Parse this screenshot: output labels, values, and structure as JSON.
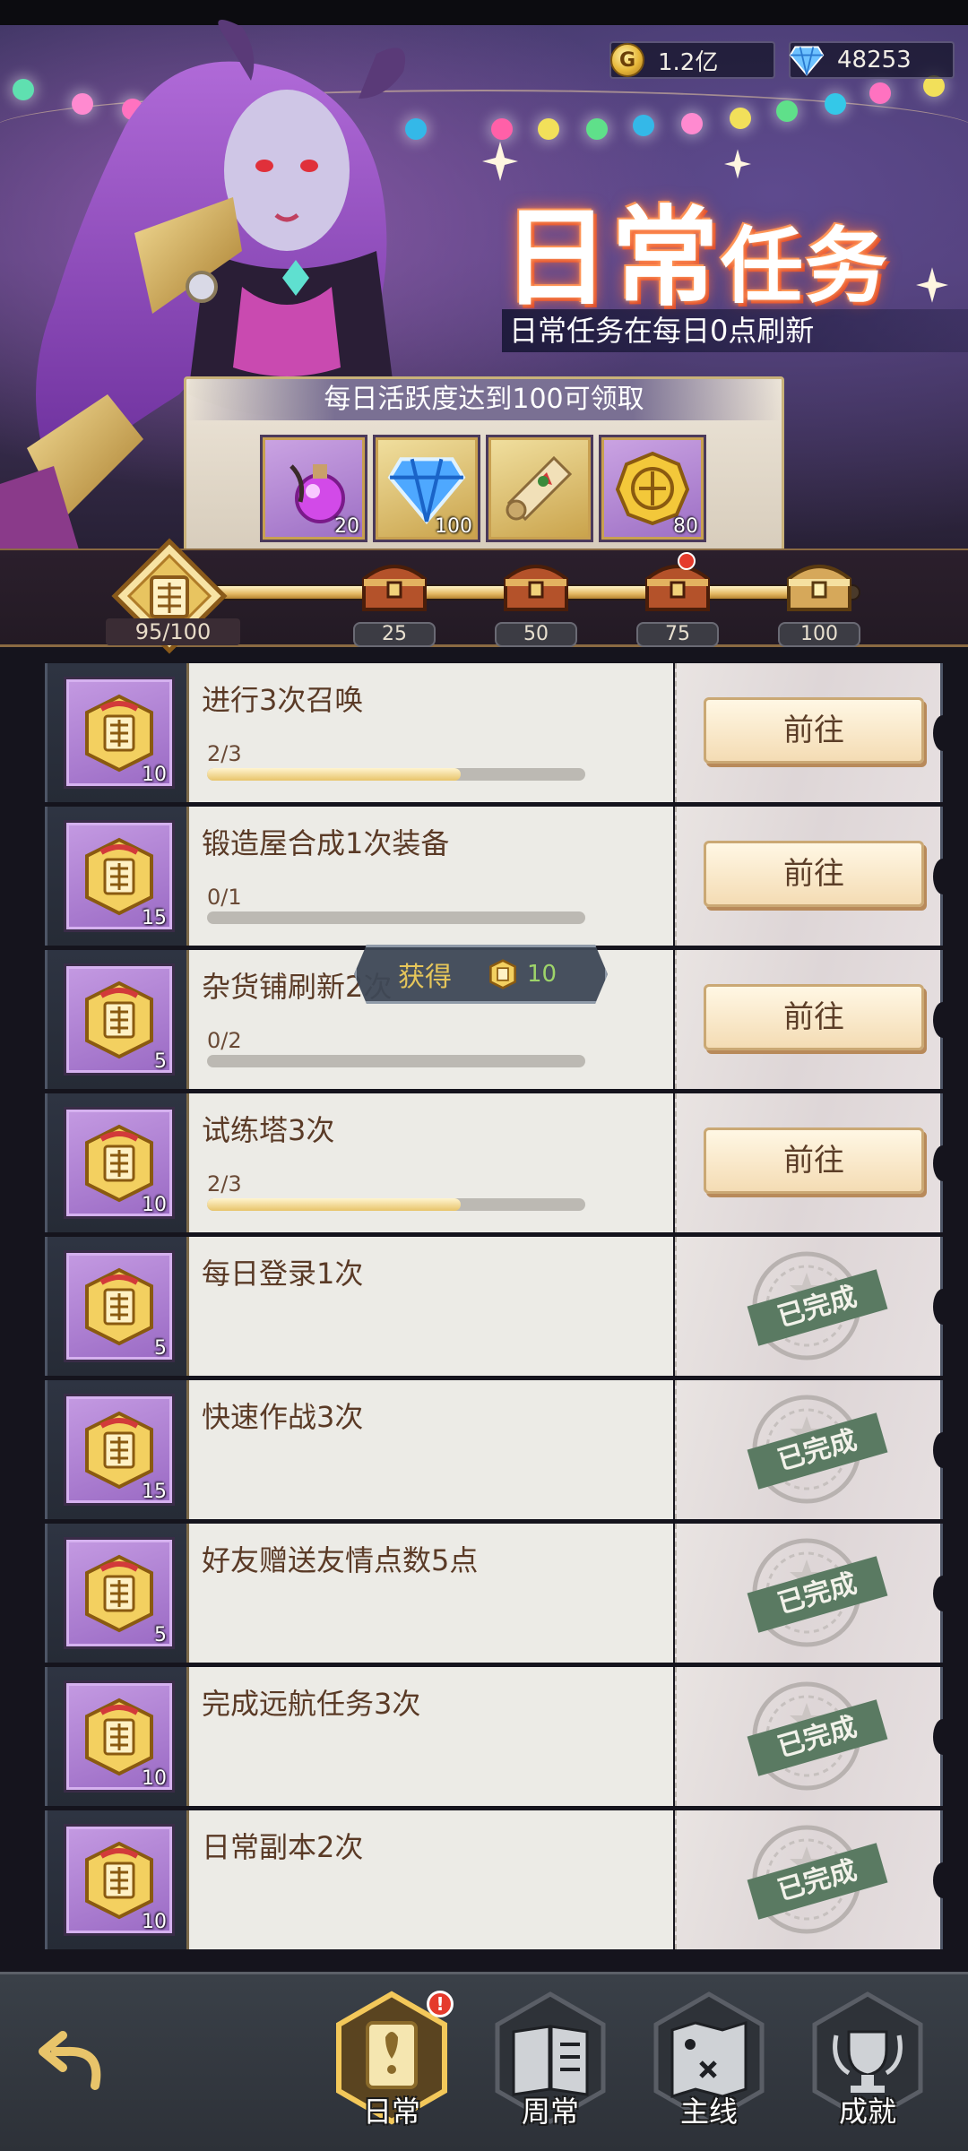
{
  "currency": {
    "gold": "1.2亿",
    "gold_symbol": "G",
    "diamond": "48253"
  },
  "header": {
    "title_big": "日常",
    "title_small": "任务",
    "subtitle": "日常任务在每日0点刷新"
  },
  "reward_panel": {
    "title": "每日活跃度达到100可领取",
    "items": [
      {
        "name": "purple-potion",
        "count": "20"
      },
      {
        "name": "blue-diamond",
        "count": "100"
      },
      {
        "name": "scroll",
        "count": ""
      },
      {
        "name": "gold-coin",
        "count": "80"
      }
    ]
  },
  "activity": {
    "current": "95/100",
    "progress": 0.95,
    "milestones": [
      "25",
      "50",
      "75",
      "100"
    ]
  },
  "tasks": [
    {
      "name": "进行3次召唤",
      "reward": "10",
      "progress_text": "2/3",
      "progress": 0.67,
      "state": "go",
      "button": "前往"
    },
    {
      "name": "锻造屋合成1次装备",
      "reward": "15",
      "progress_text": "0/1",
      "progress": 0,
      "state": "go",
      "button": "前往"
    },
    {
      "name": "杂货铺刷新2次",
      "reward": "5",
      "progress_text": "0/2",
      "progress": 0,
      "state": "go",
      "button": "前往"
    },
    {
      "name": "试练塔3次",
      "reward": "10",
      "progress_text": "2/3",
      "progress": 0.67,
      "state": "go",
      "button": "前往"
    },
    {
      "name": "每日登录1次",
      "reward": "5",
      "state": "done",
      "stamp": "已完成"
    },
    {
      "name": "快速作战3次",
      "reward": "15",
      "state": "done",
      "stamp": "已完成"
    },
    {
      "name": "好友赠送友情点数5点",
      "reward": "5",
      "state": "done",
      "stamp": "已完成"
    },
    {
      "name": "完成远航任务3次",
      "reward": "10",
      "state": "done",
      "stamp": "已完成"
    },
    {
      "name": "日常副本2次",
      "reward": "10",
      "state": "done",
      "stamp": "已完成"
    }
  ],
  "toast": {
    "label": "获得",
    "amount": "10"
  },
  "nav": {
    "tabs": [
      {
        "label": "日常",
        "active": true,
        "badge": "!"
      },
      {
        "label": "周常",
        "active": false
      },
      {
        "label": "主线",
        "active": false
      },
      {
        "label": "成就",
        "active": false
      }
    ]
  },
  "colors": {
    "accent_gold": "#e4b964",
    "done_green": "#5a7a62",
    "panel_bg": "#ecebe6"
  }
}
